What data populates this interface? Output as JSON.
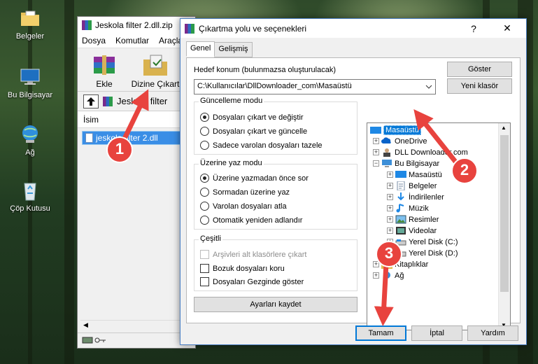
{
  "desktop": {
    "icons": [
      {
        "label": "Belgeler",
        "icon": "folder-documents-icon"
      },
      {
        "label": "Bu Bilgisayar",
        "icon": "computer-icon"
      },
      {
        "label": "Ağ",
        "icon": "network-icon"
      },
      {
        "label": "Çöp Kutusu",
        "icon": "recycle-bin-icon"
      }
    ]
  },
  "winrar": {
    "title": "Jeskola filter 2.dll.zip",
    "menu": [
      "Dosya",
      "Komutlar",
      "Araçla"
    ],
    "toolbar": {
      "add_label": "Ekle",
      "extract_label": "Dizine Çıkart"
    },
    "path_text": "Jeskola filter",
    "list_header": "İsim",
    "file_name": "jeskola filter 2.dll"
  },
  "dialog": {
    "title": "Çıkartma yolu ve seçenekleri",
    "help_glyph": "?",
    "close_glyph": "✕",
    "tabs": [
      "Genel",
      "Gelişmiş"
    ],
    "destination_label": "Hedef konum (bulunmazsa oluşturulacak)",
    "destination_value": "C:\\Kullanıcılar\\DllDownloader_com\\Masaüstü",
    "show_button": "Göster",
    "new_folder_button": "Yeni klasör",
    "update_mode": {
      "title": "Güncelleme modu",
      "options": [
        "Dosyaları çıkart ve değiştir",
        "Dosyaları çıkart ve güncelle",
        "Sadece varolan dosyaları tazele"
      ]
    },
    "overwrite_mode": {
      "title": "Üzerine yaz modu",
      "options": [
        "Üzerine yazmadan önce sor",
        "Sormadan üzerine yaz",
        "Varolan dosyaları atla",
        "Otomatik yeniden adlandır"
      ]
    },
    "misc": {
      "title": "Çeşitli",
      "options": [
        "Arşivleri alt klasörlere çıkart",
        "Bozuk dosyaları koru",
        "Dosyaları Gezginde göster"
      ]
    },
    "save_settings_button": "Ayarları kaydet",
    "tree": [
      {
        "label": "Masaüstü",
        "icon": "desktop-folder-icon"
      },
      {
        "label": "OneDrive",
        "icon": "onedrive-icon"
      },
      {
        "label": "DLL Downloader.com",
        "icon": "user-icon"
      },
      {
        "label": "Bu Bilgisayar",
        "icon": "computer-icon"
      },
      {
        "label": "Masaüstü",
        "icon": "desktop-folder-icon"
      },
      {
        "label": "Belgeler",
        "icon": "documents-icon"
      },
      {
        "label": "İndirilenler",
        "icon": "downloads-icon"
      },
      {
        "label": "Müzik",
        "icon": "music-icon"
      },
      {
        "label": "Resimler",
        "icon": "pictures-icon"
      },
      {
        "label": "Videolar",
        "icon": "videos-icon"
      },
      {
        "label": "Yerel Disk (C:)",
        "icon": "drive-icon"
      },
      {
        "label": "Yerel Disk (D:)",
        "icon": "drive-icon"
      },
      {
        "label": "Kitaplıklar",
        "icon": "libraries-icon"
      },
      {
        "label": "Ağ",
        "icon": "network-icon"
      }
    ],
    "ok_button": "Tamam",
    "cancel_button": "İptal",
    "help_button": "Yardım"
  },
  "callouts": [
    "1",
    "2",
    "3"
  ],
  "colors": {
    "accent": "#0078d7",
    "callout": "#e8433e"
  }
}
